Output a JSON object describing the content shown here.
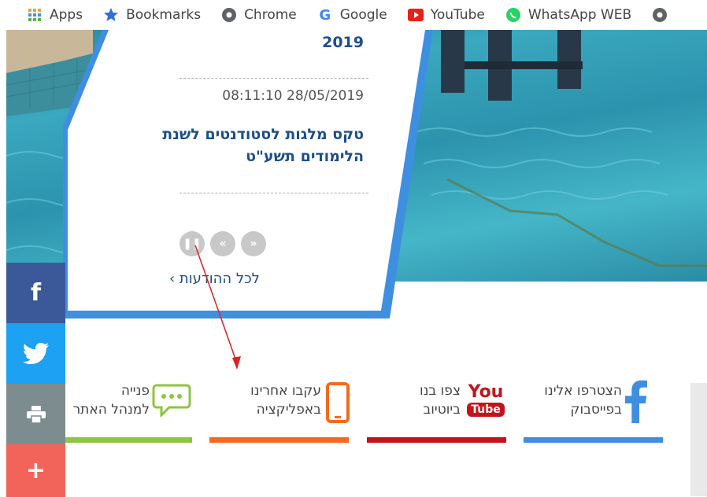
{
  "bookmarks_bar": {
    "items": [
      {
        "label": "Apps",
        "icon": "apps-grid-icon"
      },
      {
        "label": "Bookmarks",
        "icon": "star-icon"
      },
      {
        "label": "Chrome",
        "icon": "chrome-icon"
      },
      {
        "label": "Google",
        "icon": "google-icon"
      },
      {
        "label": "YouTube",
        "icon": "youtube-icon"
      },
      {
        "label": "WhatsApp WEB",
        "icon": "whatsapp-icon"
      }
    ]
  },
  "news": {
    "year_fragment": "2019",
    "date": "08:11:10 28/05/2019",
    "title": "טקס מלגות לסטודנטים לשנת הלימודים תשע\"ט",
    "all_news_label": "לכל ההודעות ›",
    "controls": [
      "pause-icon",
      "prev-icon",
      "next-icon"
    ]
  },
  "social_sidebar": {
    "items": [
      {
        "name": "facebook",
        "icon": "facebook-icon",
        "color": "#3b5998"
      },
      {
        "name": "twitter",
        "icon": "twitter-icon",
        "color": "#1da1f2"
      },
      {
        "name": "print",
        "icon": "printer-icon",
        "color": "#7d8c8e"
      },
      {
        "name": "more",
        "icon": "plus-icon",
        "color": "#f2645a"
      }
    ]
  },
  "footer_links": {
    "facebook": {
      "line1": "הצטרפו אלינו",
      "line2": "בפייסבוק",
      "color": "#3f8fe0"
    },
    "youtube": {
      "line1": "צפו בנו",
      "line2": "ביוטיוב",
      "logo_top": "You",
      "logo_bottom": "Tube",
      "color": "#c4141b"
    },
    "app": {
      "line1": "עקבו אחרינו",
      "line2": "באפליקציה",
      "color": "#f26b1d"
    },
    "contact": {
      "line1": "פנייה",
      "line2": "למנהל האתר",
      "color": "#8dc63f"
    }
  }
}
